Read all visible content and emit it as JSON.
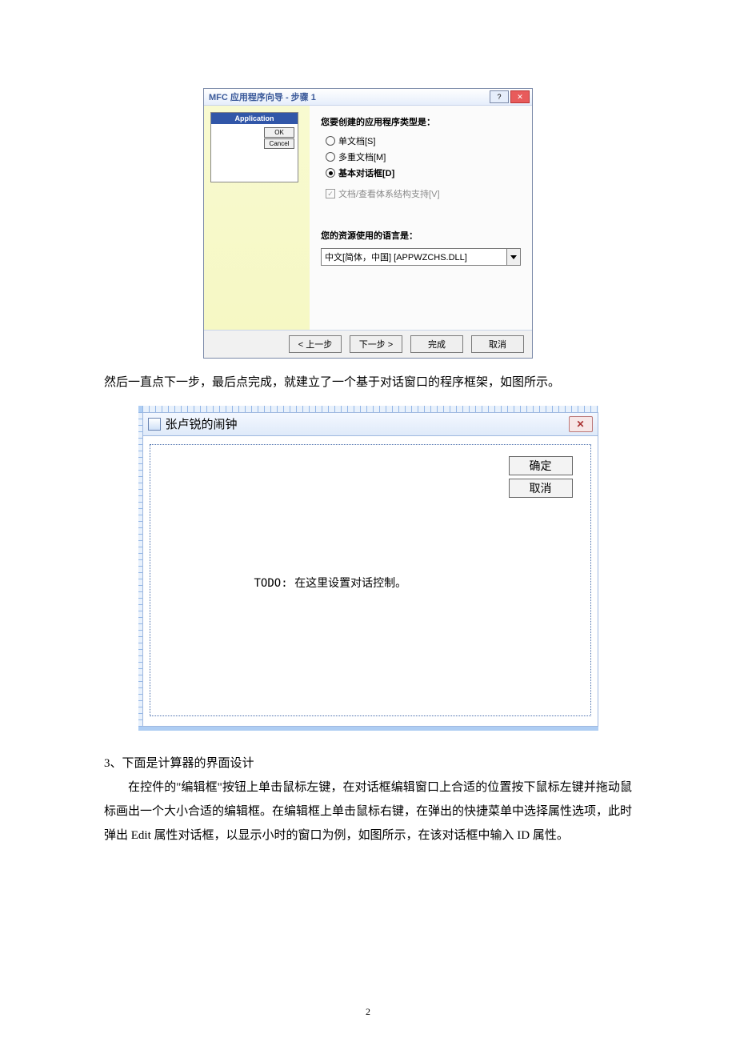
{
  "wizard": {
    "title": "MFC 应用程序向导 - 步骤 1",
    "app_label": "Application",
    "mini_ok": "OK",
    "mini_cancel": "Cancel",
    "q_type": "您要创建的应用程序类型是：",
    "opt_single": "单文档[S]",
    "opt_multi": "多重文档[M]",
    "opt_dialog": "基本对话框[D]",
    "docview": "文档/查看体系结构支持[V]",
    "q_lang": "您的资源使用的语言是：",
    "lang_value": "中文[简体，中国] [APPWZCHS.DLL]",
    "btn_prev": "< 上一步",
    "btn_next": "下一步 >",
    "btn_finish": "完成",
    "btn_cancel": "取消",
    "help_glyph": "?",
    "close_glyph": "✕"
  },
  "caption1": "然后一直点下一步，最后点完成，就建立了一个基于对话窗口的程序框架，如图所示。",
  "editor": {
    "title": "张卢锐的闹钟",
    "ok": "确定",
    "cancel": "取消",
    "todo": "TODO: 在这里设置对话控制。",
    "close_glyph": "✕"
  },
  "section": {
    "heading": "3、下面是计算器的界面设计",
    "p1": "在控件的\"编辑框\"按钮上单击鼠标左键，在对话框编辑窗口上合适的位置按下鼠标左键并拖动鼠标画出一个大小合适的编辑框。在编辑框上单击鼠标右键，在弹出的快捷菜单中选择属性选项，此时弹出 Edit 属性对话框，以显示小时的窗口为例，如图所示，在该对话框中输入 ID 属性。"
  },
  "page_number": "2"
}
